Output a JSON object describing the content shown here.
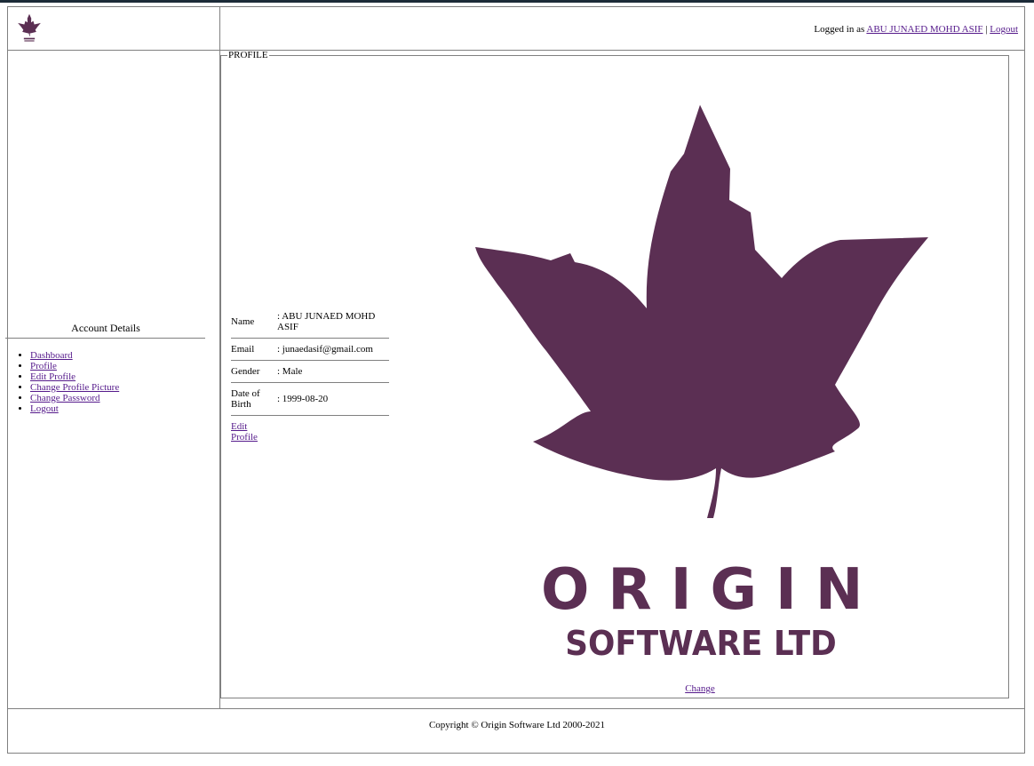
{
  "header": {
    "logged_in_prefix": "Logged in as",
    "user_name": "ABU JUNAED MOHD ASIF",
    "separator": "|",
    "logout": "Logout"
  },
  "sidebar": {
    "title": "Account Details",
    "items": [
      {
        "label": "Dashboard"
      },
      {
        "label": "Profile"
      },
      {
        "label": "Edit Profile"
      },
      {
        "label": "Change Profile Picture"
      },
      {
        "label": "Change Password"
      },
      {
        "label": "Logout"
      }
    ]
  },
  "profile": {
    "legend": "PROFILE",
    "rows": [
      {
        "label": "Name",
        "value": ": ABU JUNAED MOHD ASIF"
      },
      {
        "label": "Email",
        "value": ": junaedasif@gmail.com"
      },
      {
        "label": "Gender",
        "value": ": Male"
      },
      {
        "label": "Date of Birth",
        "value": ": 1999-08-20"
      }
    ],
    "edit_link": "Edit Profile",
    "change_link": "Change",
    "picture_brand_line1": "ORIGIN",
    "picture_brand_line2": "SOFTWARE LTD"
  },
  "footer": {
    "copyright": "Copyright © Origin Software Ltd 2000-2021"
  },
  "colors": {
    "brand": "#5b2f53",
    "link": "#551a8b",
    "rule": "#808080"
  },
  "icons": {
    "header_logo": "maple-leaf-logo-icon",
    "profile_picture": "maple-leaf-logo-icon"
  }
}
